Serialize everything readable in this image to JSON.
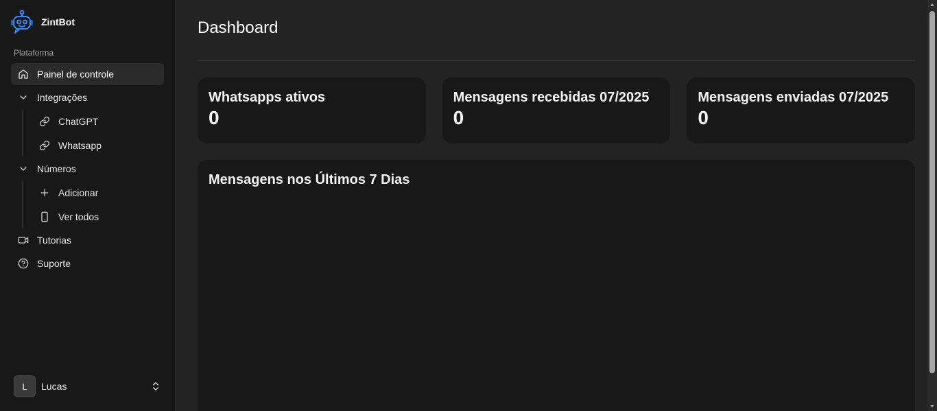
{
  "brand": {
    "name": "ZintBot"
  },
  "sidebar": {
    "group_label": "Plataforma",
    "items": [
      {
        "label": "Painel de controle",
        "icon": "home-icon"
      },
      {
        "label": "Integrações",
        "icon": "chevron-down-icon"
      },
      {
        "label": "ChatGPT",
        "icon": "link-icon"
      },
      {
        "label": "Whatsapp",
        "icon": "link-icon"
      },
      {
        "label": "Números",
        "icon": "chevron-down-icon"
      },
      {
        "label": "Adicionar",
        "icon": "plus-icon"
      },
      {
        "label": "Ver todos",
        "icon": "smartphone-icon"
      },
      {
        "label": "Tutorias",
        "icon": "video-icon"
      },
      {
        "label": "Suporte",
        "icon": "help-circle-icon"
      }
    ]
  },
  "user": {
    "initial": "L",
    "name": "Lucas"
  },
  "page": {
    "title": "Dashboard"
  },
  "cards": [
    {
      "title": "Whatsapps ativos",
      "value": "0"
    },
    {
      "title": "Mensagens recebidas 07/2025",
      "value": "0"
    },
    {
      "title": "Mensagens enviadas 07/2025",
      "value": "0"
    }
  ],
  "chart": {
    "title": "Mensagens nos Últimos 7 Dias"
  },
  "colors": {
    "background": "#232323",
    "sidebar": "#181818",
    "card": "#181818",
    "accent": "#2f8cff"
  }
}
